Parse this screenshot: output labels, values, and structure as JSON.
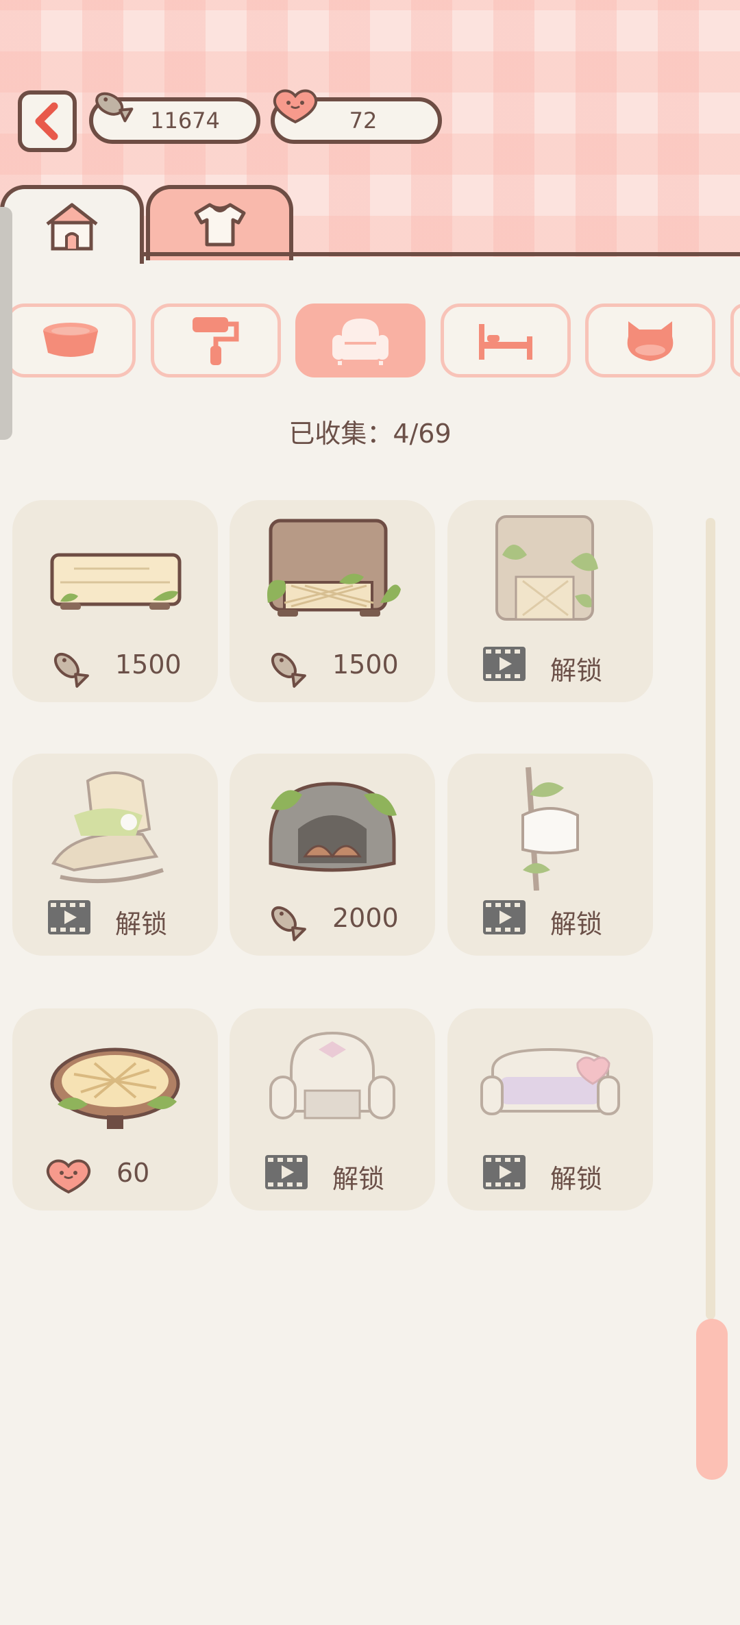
{
  "currency": {
    "fish": "11674",
    "hearts": "72"
  },
  "tabs": [
    {
      "icon": "house-icon",
      "active": true
    },
    {
      "icon": "shirt-icon",
      "active": false
    }
  ],
  "categories": [
    {
      "icon": "food-bowl-icon",
      "active": false
    },
    {
      "icon": "paint-roller-icon",
      "active": false
    },
    {
      "icon": "armchair-icon",
      "active": true
    },
    {
      "icon": "bed-icon",
      "active": false
    },
    {
      "icon": "cat-bed-icon",
      "active": false
    }
  ],
  "collected_label": "已收集：4/69",
  "items": [
    {
      "name": "wooden-bench",
      "price_type": "fish",
      "price": "1500"
    },
    {
      "name": "ivy-armchair-brown",
      "price_type": "fish",
      "price": "1500"
    },
    {
      "name": "ivy-armchair-beige",
      "price_type": "video",
      "price": "解锁"
    },
    {
      "name": "rattan-rocking-chair",
      "price_type": "video",
      "price": "解锁"
    },
    {
      "name": "stone-fireplace",
      "price_type": "fish",
      "price": "2000"
    },
    {
      "name": "vine-coat-rack",
      "price_type": "video",
      "price": "解锁"
    },
    {
      "name": "round-lattice-table",
      "price_type": "heart",
      "price": "60"
    },
    {
      "name": "white-ornate-chair",
      "price_type": "video",
      "price": "解锁"
    },
    {
      "name": "pastel-sofa",
      "price_type": "video",
      "price": "解锁"
    }
  ],
  "colors": {
    "accent": "#f9b1a3",
    "outline": "#6e4d44",
    "card": "#efe9dd",
    "background": "#f5f2ec"
  }
}
